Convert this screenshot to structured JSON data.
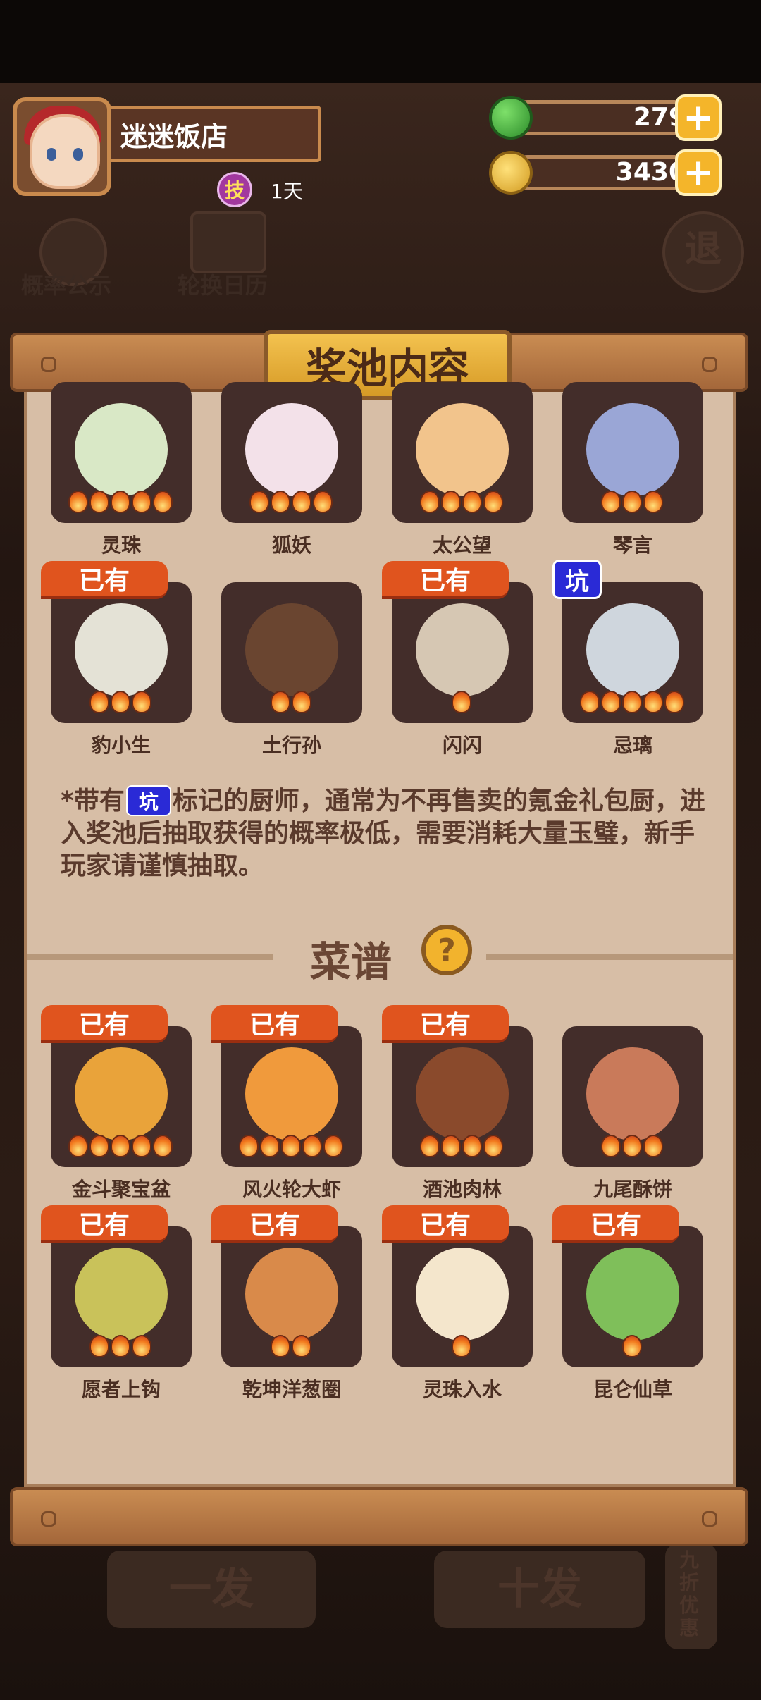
{
  "header": {
    "shop_name": "迷迷饭店",
    "skill_badge": "技",
    "days": "1天",
    "jade_amount": "279",
    "coin_amount": "3430",
    "plus_symbol": "+"
  },
  "background_buttons": {
    "probability": "概率公示",
    "rotation": "轮换日历",
    "exit": "退",
    "single_draw": "一发",
    "ten_draw": "十发",
    "discount": "九折优惠"
  },
  "panel": {
    "title": "奖池内容",
    "chefs": [
      {
        "name": "灵珠",
        "stars": 5,
        "tag": "",
        "color": "#d9e8c6"
      },
      {
        "name": "狐妖",
        "stars": 4,
        "tag": "",
        "color": "#f3e1e9"
      },
      {
        "name": "太公望",
        "stars": 4,
        "tag": "",
        "color": "#f2c48c"
      },
      {
        "name": "琴言",
        "stars": 3,
        "tag": "",
        "color": "#9aa6d6"
      },
      {
        "name": "豹小生",
        "stars": 3,
        "tag": "已有",
        "color": "#e4e2d6"
      },
      {
        "name": "土行孙",
        "stars": 2,
        "tag": "",
        "color": "#6a4530"
      },
      {
        "name": "闪闪",
        "stars": 1,
        "tag": "已有",
        "color": "#d6c7b3"
      },
      {
        "name": "忌璃",
        "stars": 5,
        "tag": "坑",
        "color": "#cfd6dd"
      }
    ],
    "note_pre": "*带有",
    "note_pit": "坑",
    "note_post": "标记的厨师，通常为不再售卖的氪金礼包厨，进入奖池后抽取获得的概率极低，需要消耗大量玉璧，新手玩家请谨慎抽取。",
    "recipe_title": "菜谱",
    "help_symbol": "?",
    "recipes": [
      {
        "name": "金斗聚宝盆",
        "stars": 5,
        "tag": "已有",
        "color": "#e9a33a"
      },
      {
        "name": "风火轮大虾",
        "stars": 5,
        "tag": "已有",
        "color": "#f09a3c"
      },
      {
        "name": "酒池肉林",
        "stars": 4,
        "tag": "已有",
        "color": "#8a4a2c"
      },
      {
        "name": "九尾酥饼",
        "stars": 3,
        "tag": "",
        "color": "#c97a5a"
      },
      {
        "name": "愿者上钩",
        "stars": 3,
        "tag": "已有",
        "color": "#c9c25a"
      },
      {
        "name": "乾坤洋葱圈",
        "stars": 2,
        "tag": "已有",
        "color": "#d98a4a"
      },
      {
        "name": "灵珠入水",
        "stars": 1,
        "tag": "已有",
        "color": "#f4e6cc"
      },
      {
        "name": "昆仑仙草",
        "stars": 1,
        "tag": "已有",
        "color": "#7fbf5a"
      }
    ]
  }
}
